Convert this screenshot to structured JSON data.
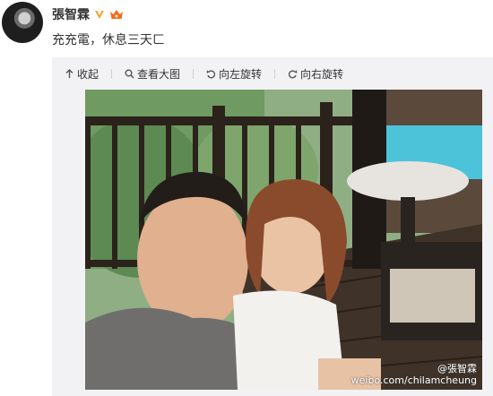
{
  "post": {
    "username": "張智霖",
    "text": "充充電，休息三天ㄈ"
  },
  "toolbar": {
    "collapse_label": "收起",
    "view_large_label": "查看大图",
    "rotate_left_label": "向左旋转",
    "rotate_right_label": "向右旋转"
  },
  "photo": {
    "watermark_handle": "@張智霖",
    "watermark_url": "weibo.com/chilamcheung"
  },
  "colors": {
    "verified": "#f5a623",
    "vip": "#f46b18",
    "text": "#333333",
    "media_bg": "#f2f2f5"
  }
}
